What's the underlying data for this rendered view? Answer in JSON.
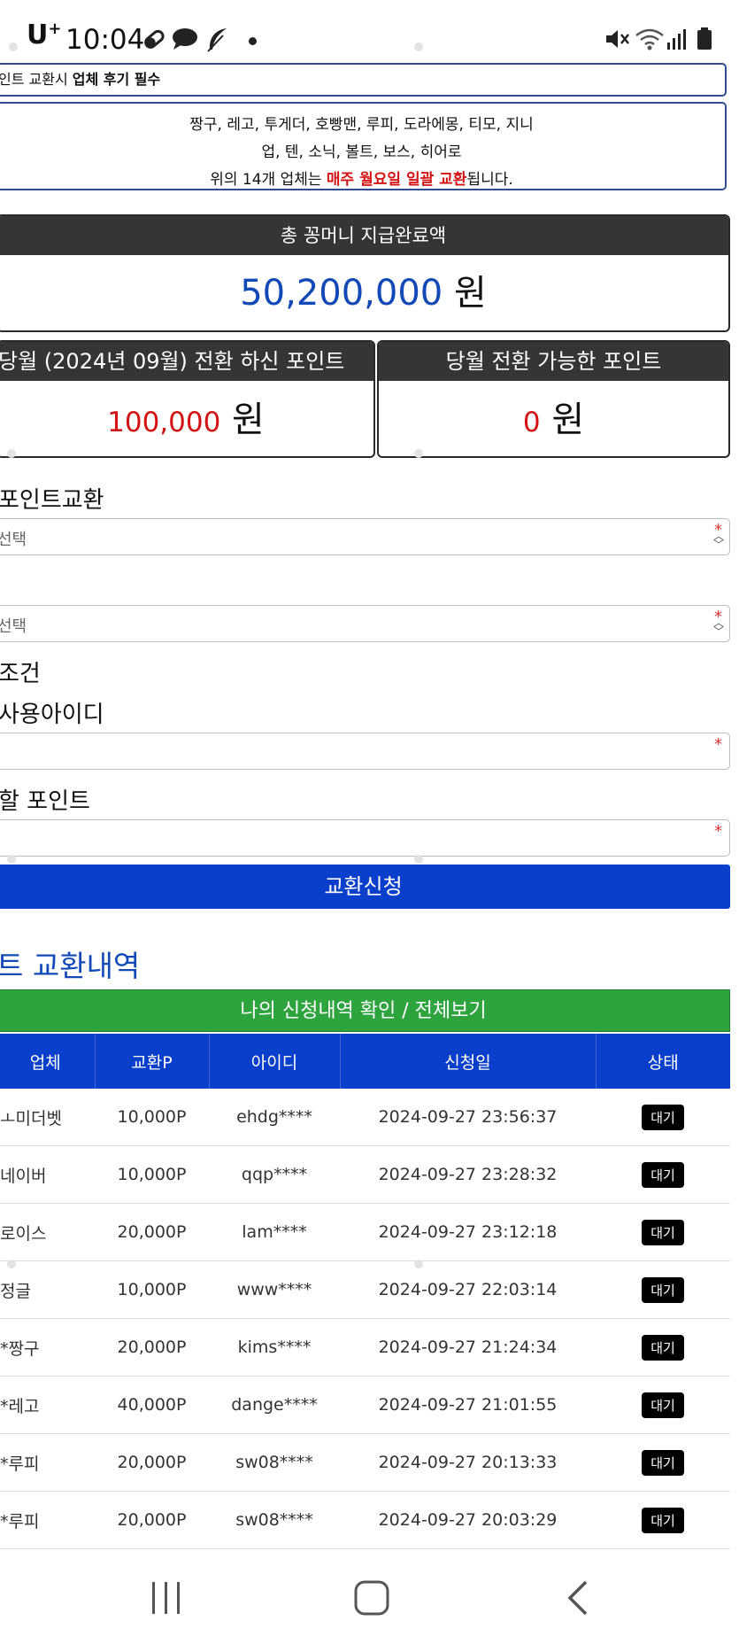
{
  "status_bar": {
    "carrier": "U",
    "carrier_sup": "+",
    "time": "10:04"
  },
  "notice": {
    "line1_prefix": "인트 교환시 ",
    "line1_bold": "업체 후기 필수",
    "line2": "짱구, 레고, 투게더, 호빵맨, 루피, 도라에몽, 티모, 지니",
    "line3": "업, 텐, 소닉, 볼트, 보스, 히어로",
    "line4_prefix": "위의 14개 업체는 ",
    "line4_red": "매주 월요일 일괄 교환",
    "line4_suffix": "됩니다."
  },
  "total": {
    "title": "총 꽁머니 지급완료액",
    "amount": "50,200,000",
    "unit": "원"
  },
  "month_points": {
    "title": "당월 (2024년 09월) 전환 하신 포인트",
    "amount": "100,000",
    "unit": "원"
  },
  "available_points": {
    "title": "당월 전환 가능한 포인트",
    "amount": "0",
    "unit": "원"
  },
  "form": {
    "section_label": "포인트교환",
    "select1_placeholder": "선택",
    "select2_placeholder": "선택",
    "condition_label": "조건",
    "userid_label": "사용아이디",
    "points_label": "할 포인트",
    "submit_label": "교환신청"
  },
  "history": {
    "title": "트 교환내역",
    "view_all_label": "나의 신청내역 확인 / 전체보기",
    "columns": [
      "업체",
      "교환P",
      "아이디",
      "신청일",
      "상태"
    ],
    "rows": [
      [
        "ㅗ미더벳",
        "10,000P",
        "ehdg****",
        "2024-09-27 23:56:37",
        "대기"
      ],
      [
        "네이버",
        "10,000P",
        "qqp****",
        "2024-09-27 23:28:32",
        "대기"
      ],
      [
        "로이스",
        "20,000P",
        "lam****",
        "2024-09-27 23:12:18",
        "대기"
      ],
      [
        "정글",
        "10,000P",
        "www****",
        "2024-09-27 22:03:14",
        "대기"
      ],
      [
        "*짱구",
        "20,000P",
        "kims****",
        "2024-09-27 21:24:34",
        "대기"
      ],
      [
        "*레고",
        "40,000P",
        "dange****",
        "2024-09-27 21:01:55",
        "대기"
      ],
      [
        "*루피",
        "20,000P",
        "sw08****",
        "2024-09-27 20:13:33",
        "대기"
      ],
      [
        "*루피",
        "20,000P",
        "sw08****",
        "2024-09-27 20:03:29",
        "대기"
      ]
    ]
  },
  "colors": {
    "accent_blue": "#0a3fcc",
    "amount_blue": "#1149b6",
    "red": "#d31213",
    "green": "#2ea43e",
    "header_dark": "#353535"
  }
}
